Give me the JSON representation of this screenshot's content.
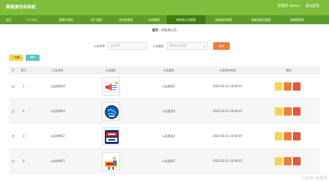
{
  "header": {
    "app_title": "新能源充电系统",
    "user_label": "管理员 admin",
    "logout_label": "退出登录"
  },
  "nav": {
    "items": [
      {
        "label": "首页"
      },
      {
        "label": "个人中心"
      },
      {
        "label": "管理员管理"
      },
      {
        "label": "用户管理"
      },
      {
        "label": "充电桩管理"
      },
      {
        "label": "充电管理"
      },
      {
        "label": "新能源公告管理"
      },
      {
        "label": "维修服务管理"
      },
      {
        "label": "新能源建议管理"
      },
      {
        "label": "轮播图管理"
      }
    ],
    "active_index": 6
  },
  "breadcrumb": {
    "home": "首页",
    "separator": "/",
    "current": "新能源公告"
  },
  "search": {
    "name_label": "公告名称",
    "name_placeholder": "公告名称",
    "type_label": "公告类型",
    "type_placeholder": "请选择公告类型",
    "button_label": "查询"
  },
  "actions": {
    "add_label": "+ 新增",
    "delete_label": "删除"
  },
  "table": {
    "headers": [
      "索引",
      "公告名称",
      "公告图片",
      "公告类型",
      "公告发布时间",
      "操作"
    ],
    "rows": [
      {
        "index": "1",
        "name": "公告名称14",
        "type": "公告类型2",
        "time": "2023-03-11 10:04:07",
        "image": "megaphone"
      },
      {
        "index": "2",
        "name": "公告名称13",
        "type": "公告类型2",
        "time": "2023-03-11 10:04:07",
        "image": "globe"
      },
      {
        "index": "3",
        "name": "公告名称12",
        "type": "公告类型2",
        "time": "2023-03-11 10:04:07",
        "image": "cctv-news"
      },
      {
        "index": "4",
        "name": "公告名称11",
        "type": "公告类型1",
        "time": "2023-03-11 10:04:07",
        "image": "news-figure"
      }
    ]
  },
  "watermark": "CSDN @程序",
  "colors": {
    "topbar": "#7fbd3c",
    "nav": "#5d9e2a",
    "nav_active": "#3f7d14",
    "yellow": "#f7d54f",
    "orange": "#f07c3c",
    "red": "#e2593b",
    "teal": "#5dc4c0"
  }
}
